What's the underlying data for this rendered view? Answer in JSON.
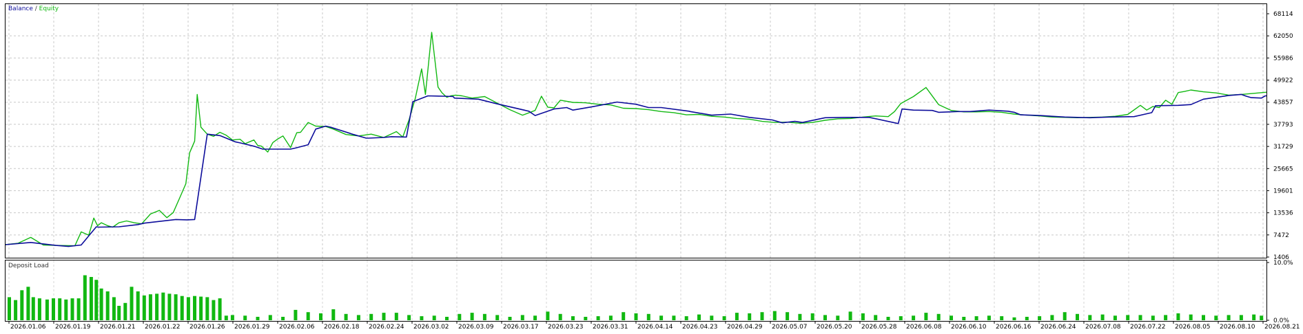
{
  "chart_data": [
    {
      "type": "line",
      "legend": {
        "items": [
          {
            "name": "Balance",
            "color": "#0b0b9a"
          },
          {
            "name": "Equity",
            "color": "#11b811"
          }
        ],
        "separator": " / ",
        "position": "top-left"
      },
      "ylim": [
        1406,
        71098
      ],
      "yticks": [
        "68114",
        "62050",
        "55986",
        "49922",
        "43857",
        "37793",
        "31729",
        "25665",
        "19601",
        "13536",
        "7472",
        "1406"
      ],
      "grid": true,
      "x_date_labels": [
        "2026.01.06",
        "2026.01.19",
        "2026.01.21",
        "2026.01.22",
        "2026.01.26",
        "2026.01.29",
        "2026.02.06",
        "2026.02.18",
        "2026.02.24",
        "2026.03.02",
        "2026.03.09",
        "2026.03.17",
        "2026.03.23",
        "2026.03.31",
        "2026.04.14",
        "2026.04.23",
        "2026.04.29",
        "2026.05.07",
        "2026.05.20",
        "2026.05.28",
        "2026.06.08",
        "2026.06.10",
        "2026.06.16",
        "2026.06.24",
        "2026.07.08",
        "2026.07.22",
        "2026.08.05",
        "2026.08.10",
        "2026.08.21"
      ],
      "series": [
        {
          "name": "Balance",
          "color": "#0b0b9a",
          "x": [
            0,
            2,
            4,
            5,
            6,
            7.2,
            7.4,
            9,
            10.5,
            11,
            13.5,
            14.4,
            15,
            16,
            17,
            18.2,
            18.6,
            19.8,
            20.4,
            22.6,
            23,
            24,
            24.6,
            25.4,
            25.8,
            27.6,
            28.6,
            28.8,
            30,
            30.6,
            31.8,
            32.3,
            33.5,
            34.8,
            35.5,
            35.6,
            37.5,
            39,
            41.5,
            42,
            43.5,
            44.5,
            45,
            46.5,
            48.5,
            50,
            51,
            52,
            54.2,
            54.3,
            56,
            57.5,
            59,
            60.8,
            61.6,
            62.6,
            63.2,
            65,
            66.5,
            68.5,
            70.8,
            71.1,
            72,
            73.5,
            74,
            75.5,
            76.5,
            78,
            79.5,
            80,
            80.5,
            82,
            84,
            86,
            87.5,
            89.5,
            90.9,
            91.2,
            93,
            94,
            95,
            97,
            98,
            98.4,
            98.8,
            99.6,
            99.9,
            100
          ],
          "y": [
            4800,
            5400,
            4600,
            4300,
            4700,
            9700,
            9600,
            9700,
            10300,
            10700,
            11700,
            11600,
            11700,
            35100,
            34700,
            33000,
            32700,
            31700,
            31000,
            31000,
            31300,
            32200,
            36500,
            37300,
            37000,
            35000,
            34000,
            34000,
            34200,
            34400,
            34300,
            44000,
            45600,
            45500,
            45400,
            45000,
            44700,
            43400,
            41400,
            40200,
            42000,
            42400,
            41700,
            42600,
            43900,
            43300,
            42400,
            42400,
            41400,
            41300,
            40300,
            40600,
            39700,
            39000,
            38200,
            38600,
            38300,
            39600,
            39700,
            39700,
            38000,
            42000,
            41700,
            41600,
            41100,
            41300,
            41300,
            41700,
            41400,
            41100,
            40400,
            40200,
            39800,
            39600,
            39800,
            39900,
            41000,
            42900,
            43000,
            43200,
            44700,
            45700,
            46000,
            45500,
            45100,
            45000,
            45600,
            45600
          ]
        },
        {
          "name": "Equity",
          "color": "#11b811",
          "x": [
            0,
            1,
            2,
            3,
            4,
            5.5,
            6,
            6.6,
            7,
            7.3,
            7.6,
            8.1,
            8.5,
            9,
            9.6,
            10.2,
            10.8,
            11.5,
            12.2,
            12.8,
            13.3,
            13.8,
            14.3,
            14.6,
            15,
            15.2,
            15.5,
            16,
            16.5,
            17,
            17.5,
            18,
            18.6,
            19,
            19.7,
            20,
            20.3,
            20.8,
            21.2,
            21.6,
            22,
            22.6,
            23.1,
            23.4,
            24,
            24.6,
            25.4,
            26,
            27,
            28,
            29,
            30,
            31,
            31.5,
            32,
            32.5,
            33,
            33.3,
            33.8,
            34.3,
            34.6,
            35,
            35.3,
            35.7,
            36.2,
            37,
            38,
            39,
            40,
            41,
            42,
            42.5,
            43,
            43.5,
            44,
            45,
            46,
            47,
            48,
            49,
            50,
            51,
            52,
            53,
            54,
            55,
            56,
            57,
            58,
            59,
            60,
            61,
            62,
            63,
            64,
            65,
            66,
            67,
            68,
            69,
            70,
            70.5,
            71,
            72,
            73,
            74,
            75,
            76,
            77,
            78,
            79,
            80,
            81,
            82,
            83,
            84,
            85,
            86,
            87,
            88,
            89,
            90,
            90.5,
            91,
            91.5,
            92,
            92.5,
            93,
            93.5,
            94,
            95,
            96,
            97,
            98,
            99,
            100
          ],
          "y": [
            4800,
            5200,
            6800,
            4700,
            4600,
            4500,
            8300,
            7400,
            12100,
            10000,
            10800,
            10000,
            9600,
            10800,
            11300,
            10800,
            10500,
            13200,
            14200,
            12200,
            13600,
            17500,
            21500,
            30000,
            33200,
            46000,
            37000,
            35100,
            34500,
            35600,
            34800,
            33500,
            33700,
            32500,
            33500,
            32000,
            31800,
            30200,
            32800,
            33800,
            34600,
            31400,
            35500,
            35600,
            38300,
            37300,
            37200,
            36500,
            35000,
            34600,
            35100,
            34200,
            35800,
            34300,
            39000,
            45000,
            53000,
            46000,
            63000,
            48000,
            46500,
            45200,
            45600,
            45800,
            45600,
            45000,
            45400,
            43600,
            41800,
            40300,
            41600,
            45500,
            42500,
            42300,
            44400,
            43800,
            43700,
            43300,
            43100,
            42200,
            42100,
            41800,
            41300,
            41000,
            40400,
            40500,
            40000,
            39800,
            39400,
            39200,
            38600,
            38300,
            38400,
            38100,
            38300,
            38900,
            39300,
            39400,
            39800,
            40100,
            39900,
            41300,
            43500,
            45400,
            47900,
            43200,
            41600,
            41200,
            41200,
            41300,
            41100,
            40600,
            40300,
            40100,
            39800,
            39700,
            39600,
            39700,
            39800,
            40000,
            40500,
            43000,
            41700,
            42700,
            42400,
            44400,
            43300,
            46500,
            46800,
            47200,
            46700,
            46400,
            45800,
            46000,
            46300,
            46600
          ]
        }
      ]
    },
    {
      "type": "bar",
      "title": "Deposit Load",
      "yticks": [
        "10.0%",
        "0.0%"
      ],
      "ylim": [
        0,
        10
      ],
      "x": [
        0.3,
        0.8,
        1.3,
        1.8,
        2.2,
        2.7,
        3.3,
        3.8,
        4.3,
        4.8,
        5.3,
        5.8,
        6.3,
        6.8,
        7.2,
        7.6,
        8.1,
        8.6,
        9.0,
        9.5,
        10.0,
        10.5,
        11.0,
        11.5,
        12.0,
        12.5,
        13.0,
        13.5,
        14.0,
        14.5,
        15.0,
        15.5,
        16.0,
        16.5,
        17.0,
        17.5,
        18.0,
        19.0,
        20.0,
        21.0,
        22.0,
        23.0,
        24.0,
        25.0,
        26.0,
        27.0,
        28.0,
        29.0,
        30.0,
        31.0,
        32.0,
        33.0,
        34.0,
        35.0,
        36.0,
        37.0,
        38.0,
        39.0,
        40.0,
        41.0,
        42.0,
        43.0,
        44.0,
        45.0,
        46.0,
        47.0,
        48.0,
        49.0,
        50.0,
        51.0,
        52.0,
        53.0,
        54.0,
        55.0,
        56.0,
        57.0,
        58.0,
        59.0,
        60.0,
        61.0,
        62.0,
        63.0,
        64.0,
        65.0,
        66.0,
        67.0,
        68.0,
        69.0,
        70.0,
        71.0,
        72.0,
        73.0,
        74.0,
        75.0,
        76.0,
        77.0,
        78.0,
        79.0,
        80.0,
        81.0,
        82.0,
        83.0,
        84.0,
        85.0,
        86.0,
        87.0,
        88.0,
        89.0,
        90.0,
        91.0,
        92.0,
        93.0,
        94.0,
        95.0,
        96.0,
        97.0,
        98.0,
        99.0,
        99.6
      ],
      "values": [
        4.0,
        3.5,
        5.2,
        5.8,
        4.0,
        3.8,
        3.6,
        3.8,
        3.8,
        3.6,
        3.8,
        3.8,
        7.8,
        7.5,
        7.0,
        5.5,
        5.0,
        4.0,
        2.5,
        3.0,
        5.8,
        5.0,
        4.3,
        4.5,
        4.6,
        4.8,
        4.6,
        4.5,
        4.2,
        4.0,
        4.2,
        4.1,
        4.0,
        3.5,
        3.8,
        0.8,
        0.9,
        0.8,
        0.6,
        0.9,
        0.6,
        1.8,
        1.4,
        1.2,
        1.9,
        1.1,
        0.9,
        1.1,
        1.3,
        1.3,
        0.9,
        0.7,
        0.8,
        0.6,
        1.1,
        1.3,
        1.1,
        0.9,
        0.6,
        0.9,
        0.8,
        1.5,
        1.1,
        0.7,
        0.6,
        0.7,
        0.8,
        1.4,
        1.2,
        1.1,
        0.8,
        0.8,
        0.7,
        1.0,
        0.8,
        0.7,
        1.3,
        1.2,
        1.4,
        1.6,
        1.4,
        1.1,
        1.2,
        0.9,
        0.8,
        1.5,
        1.2,
        0.9,
        0.6,
        0.7,
        0.8,
        1.3,
        1.1,
        0.8,
        0.6,
        0.7,
        0.8,
        0.7,
        0.5,
        0.6,
        0.7,
        0.9,
        1.4,
        1.1,
        0.9,
        1.0,
        0.8,
        0.9,
        0.9,
        0.8,
        0.9,
        1.2,
        1.0,
        0.9,
        0.8,
        0.9,
        0.9,
        1.0,
        0.8
      ],
      "color": "#11b811"
    }
  ]
}
